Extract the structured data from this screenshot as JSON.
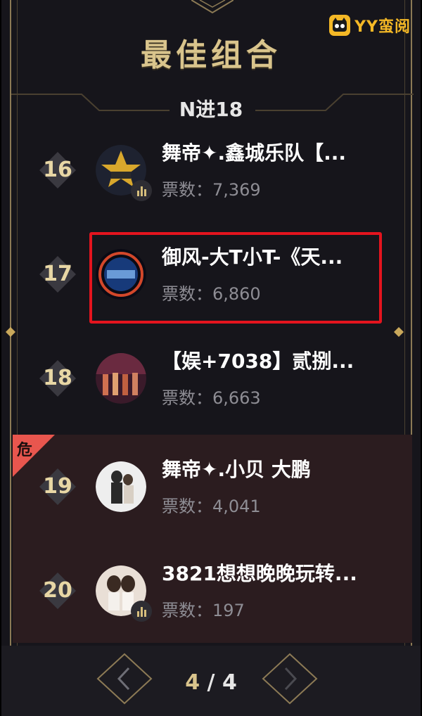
{
  "logo": {
    "text": "YY蛮阅",
    "icon": "yy-mascot-icon"
  },
  "title": "最佳组合",
  "stage": "N进18",
  "entries": [
    {
      "rank": "16",
      "name": "舞帝✦.鑫城乐队【...",
      "votes": "票数：7,369",
      "danger": false,
      "has_bars": true
    },
    {
      "rank": "17",
      "name": "御风-大T小T-《天...",
      "votes": "票数：6,860",
      "danger": false,
      "has_bars": false,
      "highlighted": true
    },
    {
      "rank": "18",
      "name": "【娱+7038】贰捌...",
      "votes": "票数：6,663",
      "danger": false,
      "has_bars": false
    },
    {
      "rank": "19",
      "name": "舞帝✦.小贝 大鹏",
      "votes": "票数：4,041",
      "danger": true,
      "has_bars": false
    },
    {
      "rank": "20",
      "name": "3821想想晚晚玩转...",
      "votes": "票数：197",
      "danger": false,
      "has_bars": true
    }
  ],
  "danger_label": "危",
  "pager": {
    "current": "4",
    "separator": "/",
    "total": "4"
  },
  "colors": {
    "gold": "#d9c48c",
    "highlight": "#e4141e",
    "danger_tag": "#e8564e",
    "background": "#16151b"
  }
}
